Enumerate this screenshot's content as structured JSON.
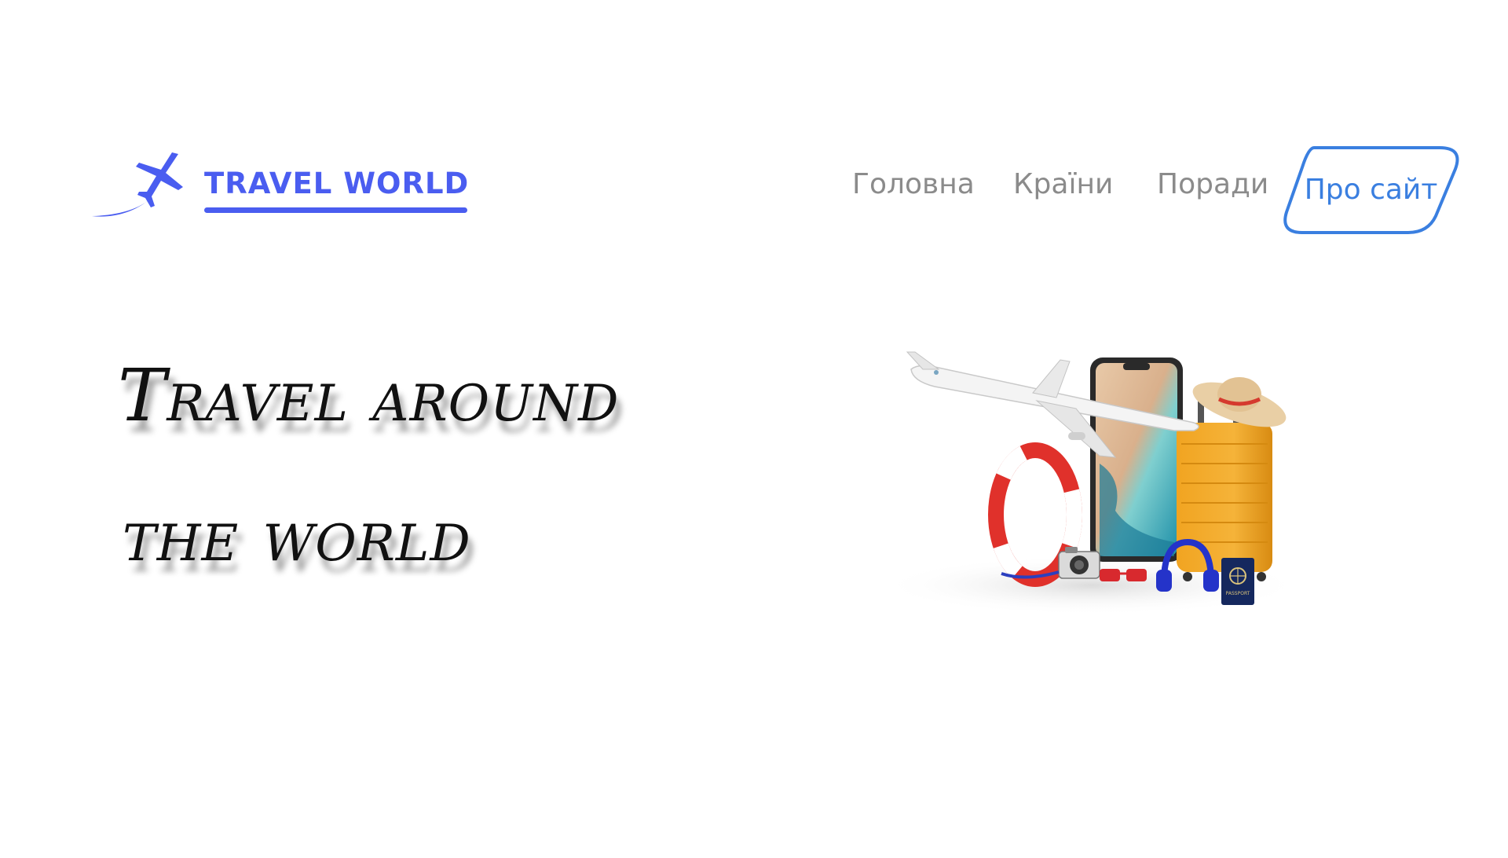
{
  "brand": {
    "name": "TRAVEL WORLD",
    "color": "#4a5df0"
  },
  "nav": {
    "items": [
      {
        "label": "Головна"
      },
      {
        "label": "Країни"
      },
      {
        "label": "Поради"
      }
    ],
    "active": {
      "label": "Про сайт",
      "color": "#3a7fe0"
    }
  },
  "hero": {
    "line1": "Travel around",
    "line2": "the world"
  },
  "illustration": {
    "passport_label": "PASSPORT"
  }
}
